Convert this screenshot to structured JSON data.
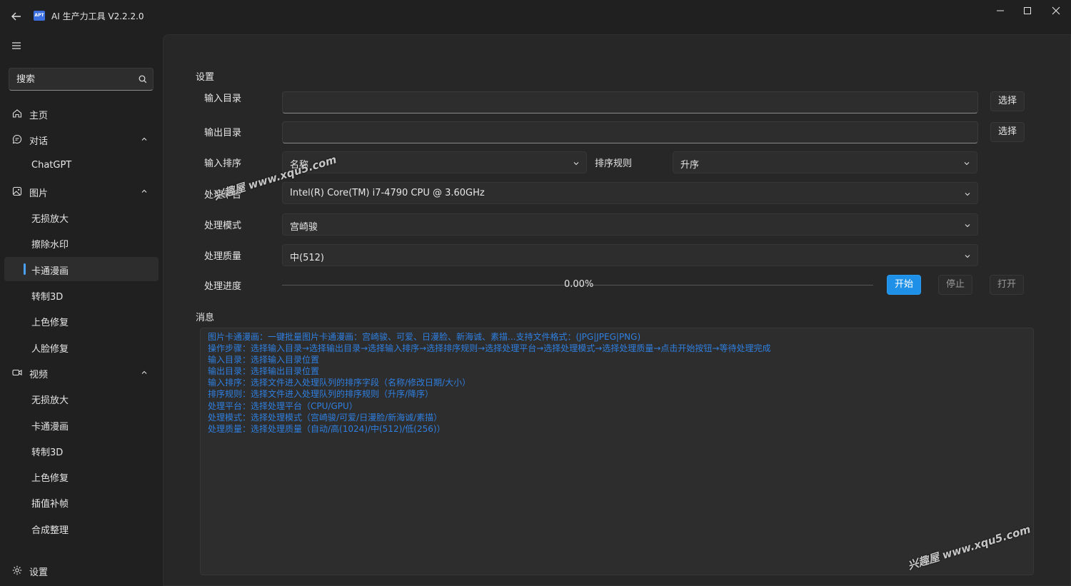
{
  "window": {
    "title": "AI 生产力工具 V2.2.2.0",
    "logo_text": "APT"
  },
  "sidebar": {
    "search_placeholder": "搜索",
    "items": [
      {
        "label": "主页",
        "type": "top",
        "icon": "home-icon"
      },
      {
        "label": "对话",
        "type": "top",
        "icon": "chat-icon",
        "expanded": true
      },
      {
        "label": "ChatGPT",
        "type": "sub"
      },
      {
        "label": "图片",
        "type": "top",
        "icon": "image-icon",
        "expanded": true
      },
      {
        "label": "无损放大",
        "type": "sub"
      },
      {
        "label": "擦除水印",
        "type": "sub"
      },
      {
        "label": "卡通漫画",
        "type": "sub",
        "active": true
      },
      {
        "label": "转制3D",
        "type": "sub"
      },
      {
        "label": "上色修复",
        "type": "sub"
      },
      {
        "label": "人脸修复",
        "type": "sub"
      },
      {
        "label": "视频",
        "type": "top",
        "icon": "video-icon",
        "expanded": true
      },
      {
        "label": "无损放大",
        "type": "sub"
      },
      {
        "label": "卡通漫画",
        "type": "sub"
      },
      {
        "label": "转制3D",
        "type": "sub"
      },
      {
        "label": "上色修复",
        "type": "sub"
      },
      {
        "label": "插值补帧",
        "type": "sub"
      },
      {
        "label": "合成整理",
        "type": "sub"
      }
    ],
    "settings_label": "设置"
  },
  "main": {
    "settings_title": "设置",
    "input_dir_label": "输入目录",
    "input_dir_value": "",
    "output_dir_label": "输出目录",
    "output_dir_value": "",
    "select_button": "选择",
    "sort_label": "输入排序",
    "sort_value": "名称",
    "sort_rule_label": "排序规则",
    "sort_rule_value": "升序",
    "platform_label": "处理平台",
    "platform_value": "Intel(R) Core(TM) i7-4790 CPU @ 3.60GHz",
    "mode_label": "处理模式",
    "mode_value": "宫崎骏",
    "quality_label": "处理质量",
    "quality_value": "中(512)",
    "progress_label": "处理进度",
    "progress_text": "0.00%",
    "progress_fraction": 0.0,
    "start_button": "开始",
    "stop_button": "停止",
    "open_button": "打开",
    "messages_title": "消息",
    "messages": [
      "图片卡通漫画：一键批量图片卡通漫画：宫崎骏、可爱、日漫脸、新海诚、素描...支持文件格式：(JPG|JPEG|PNG)",
      "操作步骤：选择输入目录→选择输出目录→选择输入排序→选择排序规则→选择处理平台→选择处理模式→选择处理质量→点击开始按钮→等待处理完成",
      "输入目录：选择输入目录位置",
      "输出目录：选择输出目录位置",
      "输入排序：选择文件进入处理队列的排序字段（名称/修改日期/大小）",
      "排序规则：选择文件进入处理队列的排序规则（升序/降序）",
      "处理平台：选择处理平台（CPU/GPU）",
      "处理模式：选择处理模式（宫崎骏/可爱/日漫脸/新海诚/素描）",
      "处理质量：选择处理质量（自动/高(1024)/中(512)/低(256)）"
    ],
    "message_color": "#2f7fe0",
    "accent_color": "#1e90e8"
  },
  "watermark": {
    "text": "兴趣屋 www.xqu5.com"
  }
}
